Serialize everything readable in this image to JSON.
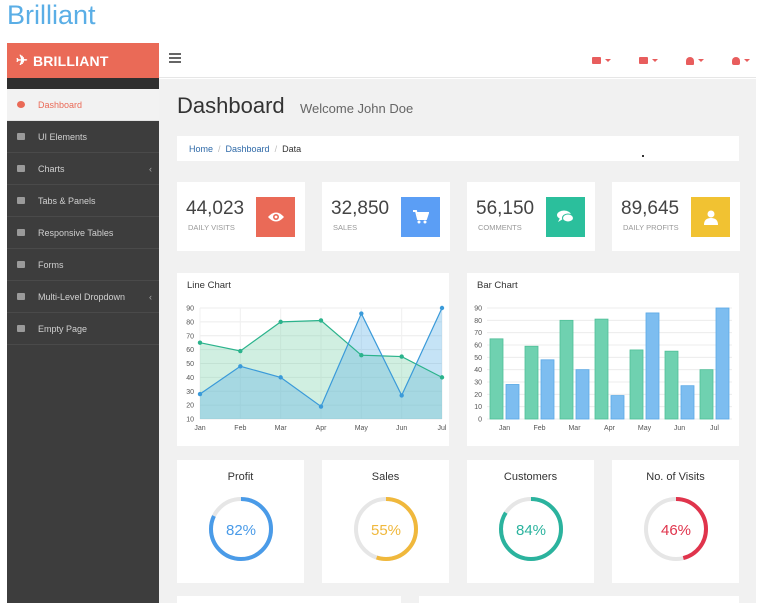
{
  "page_title": "Brilliant",
  "brand": {
    "name": "BRILLIANT",
    "icon": "plane-icon"
  },
  "nav": {
    "icons": [
      "envelope-icon",
      "tasks-icon",
      "bell-icon",
      "user-icon"
    ]
  },
  "sidebar": {
    "items": [
      {
        "label": "Dashboard",
        "icon": "dashboard-icon",
        "active": true
      },
      {
        "label": "UI Elements",
        "icon": "desktop-icon"
      },
      {
        "label": "Charts",
        "icon": "bar-chart-icon",
        "has_children": true
      },
      {
        "label": "Tabs & Panels",
        "icon": "qrcode-icon"
      },
      {
        "label": "Responsive Tables",
        "icon": "table-icon"
      },
      {
        "label": "Forms",
        "icon": "edit-icon"
      },
      {
        "label": "Multi-Level Dropdown",
        "icon": "sitemap-icon",
        "has_children": true
      },
      {
        "label": "Empty Page",
        "icon": "file-icon"
      }
    ]
  },
  "header": {
    "title": "Dashboard",
    "welcome": "Welcome John Doe"
  },
  "breadcrumb": {
    "home": "Home",
    "dashboard": "Dashboard",
    "current": "Data",
    "sep": "/"
  },
  "stats": [
    {
      "value": "44,023",
      "label": "DAILY VISITS",
      "icon": "eye-icon",
      "color": "#ea6a57"
    },
    {
      "value": "32,850",
      "label": "SALES",
      "icon": "cart-icon",
      "color": "#5b9ef5"
    },
    {
      "value": "56,150",
      "label": "COMMENTS",
      "icon": "comments-icon",
      "color": "#2bbf9c"
    },
    {
      "value": "89,645",
      "label": "DAILY PROFITS",
      "icon": "user-icon",
      "color": "#f1c232"
    }
  ],
  "chart_data": [
    {
      "type": "area",
      "title": "Line Chart",
      "categories": [
        "Jan",
        "Feb",
        "Mar",
        "Apr",
        "May",
        "Jun",
        "Jul"
      ],
      "ylim": [
        10,
        90
      ],
      "yticks": [
        10,
        20,
        30,
        40,
        50,
        60,
        70,
        80,
        90
      ],
      "grid": true,
      "series": [
        {
          "values": [
            65,
            59,
            80,
            81,
            56,
            55,
            40
          ],
          "color": "#2bb38c"
        },
        {
          "values": [
            28,
            48,
            40,
            19,
            86,
            27,
            90
          ],
          "color": "#3a9ad9"
        }
      ]
    },
    {
      "type": "bar",
      "title": "Bar Chart",
      "categories": [
        "Jan",
        "Feb",
        "Mar",
        "Apr",
        "May",
        "Jun",
        "Jul"
      ],
      "ylim": [
        0,
        90
      ],
      "yticks": [
        0,
        10,
        20,
        30,
        40,
        50,
        60,
        70,
        80,
        90
      ],
      "grid": true,
      "series": [
        {
          "values": [
            65,
            59,
            80,
            81,
            56,
            55,
            40
          ],
          "color": "#6fd1b0"
        },
        {
          "values": [
            28,
            48,
            40,
            19,
            86,
            27,
            90
          ],
          "color": "#7dbdf0"
        }
      ]
    }
  ],
  "gauges": [
    {
      "title": "Profit",
      "value": 82,
      "text": "82%",
      "color": "#4a9be8"
    },
    {
      "title": "Sales",
      "value": 55,
      "text": "55%",
      "color": "#f0b83c"
    },
    {
      "title": "Customers",
      "value": 84,
      "text": "84%",
      "color": "#2bb39e"
    },
    {
      "title": "No. of Visits",
      "value": 46,
      "text": "46%",
      "color": "#e0344c"
    }
  ]
}
